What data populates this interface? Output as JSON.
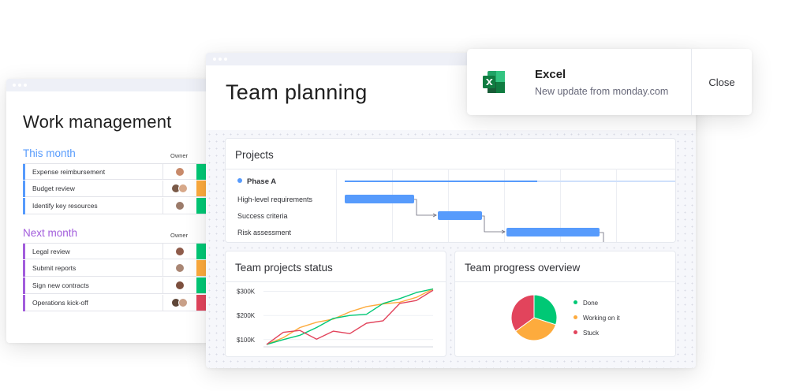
{
  "work_management": {
    "title": "Work management",
    "groups": [
      {
        "title": "This month",
        "owner_label": "Owner",
        "color": "#579bfc",
        "items": [
          {
            "label": "Expense reimbursement",
            "status_color": "#00c875"
          },
          {
            "label": "Budget review",
            "status_color": "#fdab3d"
          },
          {
            "label": "Identify key resources",
            "status_color": "#00c875"
          }
        ]
      },
      {
        "title": "Next month",
        "owner_label": "Owner",
        "color": "#a25ddc",
        "items": [
          {
            "label": "Legal review",
            "status_color": "#00c875"
          },
          {
            "label": "Submit reports",
            "status_color": "#fdab3d"
          },
          {
            "label": "Sign new contracts",
            "status_color": "#00c875"
          },
          {
            "label": "Operations kick-off",
            "status_color": "#e2445c"
          }
        ]
      }
    ]
  },
  "team_planning": {
    "title": "Team planning",
    "projects": {
      "title": "Projects",
      "phase": "Phase A",
      "tasks": [
        "High-level requirements",
        "Success criteria",
        "Risk assessment"
      ]
    },
    "status": {
      "title": "Team projects status"
    },
    "overview": {
      "title": "Team progress overview"
    }
  },
  "chart_data": [
    {
      "type": "line",
      "title": "Team projects status",
      "ylim": [
        70,
        315
      ],
      "y_ticks": [
        "$100K",
        "$200K",
        "$300K"
      ],
      "y_tick_values": [
        100,
        200,
        300
      ],
      "x": [
        0,
        1,
        2,
        3,
        4,
        5,
        6,
        7,
        8,
        9,
        10
      ],
      "series": [
        {
          "color": "#fdab3d",
          "values": [
            80,
            108,
            150,
            172,
            185,
            215,
            237,
            248,
            255,
            275,
            310
          ]
        },
        {
          "color": "#00c875",
          "values": [
            80,
            100,
            118,
            150,
            188,
            200,
            205,
            250,
            270,
            295,
            310
          ]
        },
        {
          "color": "#e2445c",
          "values": [
            80,
            130,
            138,
            102,
            135,
            125,
            168,
            178,
            250,
            262,
            305
          ]
        }
      ]
    },
    {
      "type": "pie",
      "title": "Team progress overview",
      "slices": [
        {
          "label": "Done",
          "value": 30,
          "color": "#00c875"
        },
        {
          "label": "Working on it",
          "value": 35,
          "color": "#fdab3d"
        },
        {
          "label": "Stuck",
          "value": 35,
          "color": "#e2445c"
        }
      ]
    }
  ],
  "notification": {
    "app": "Excel",
    "message": "New update from monday.com",
    "close_label": "Close",
    "icon": "excel-icon"
  }
}
